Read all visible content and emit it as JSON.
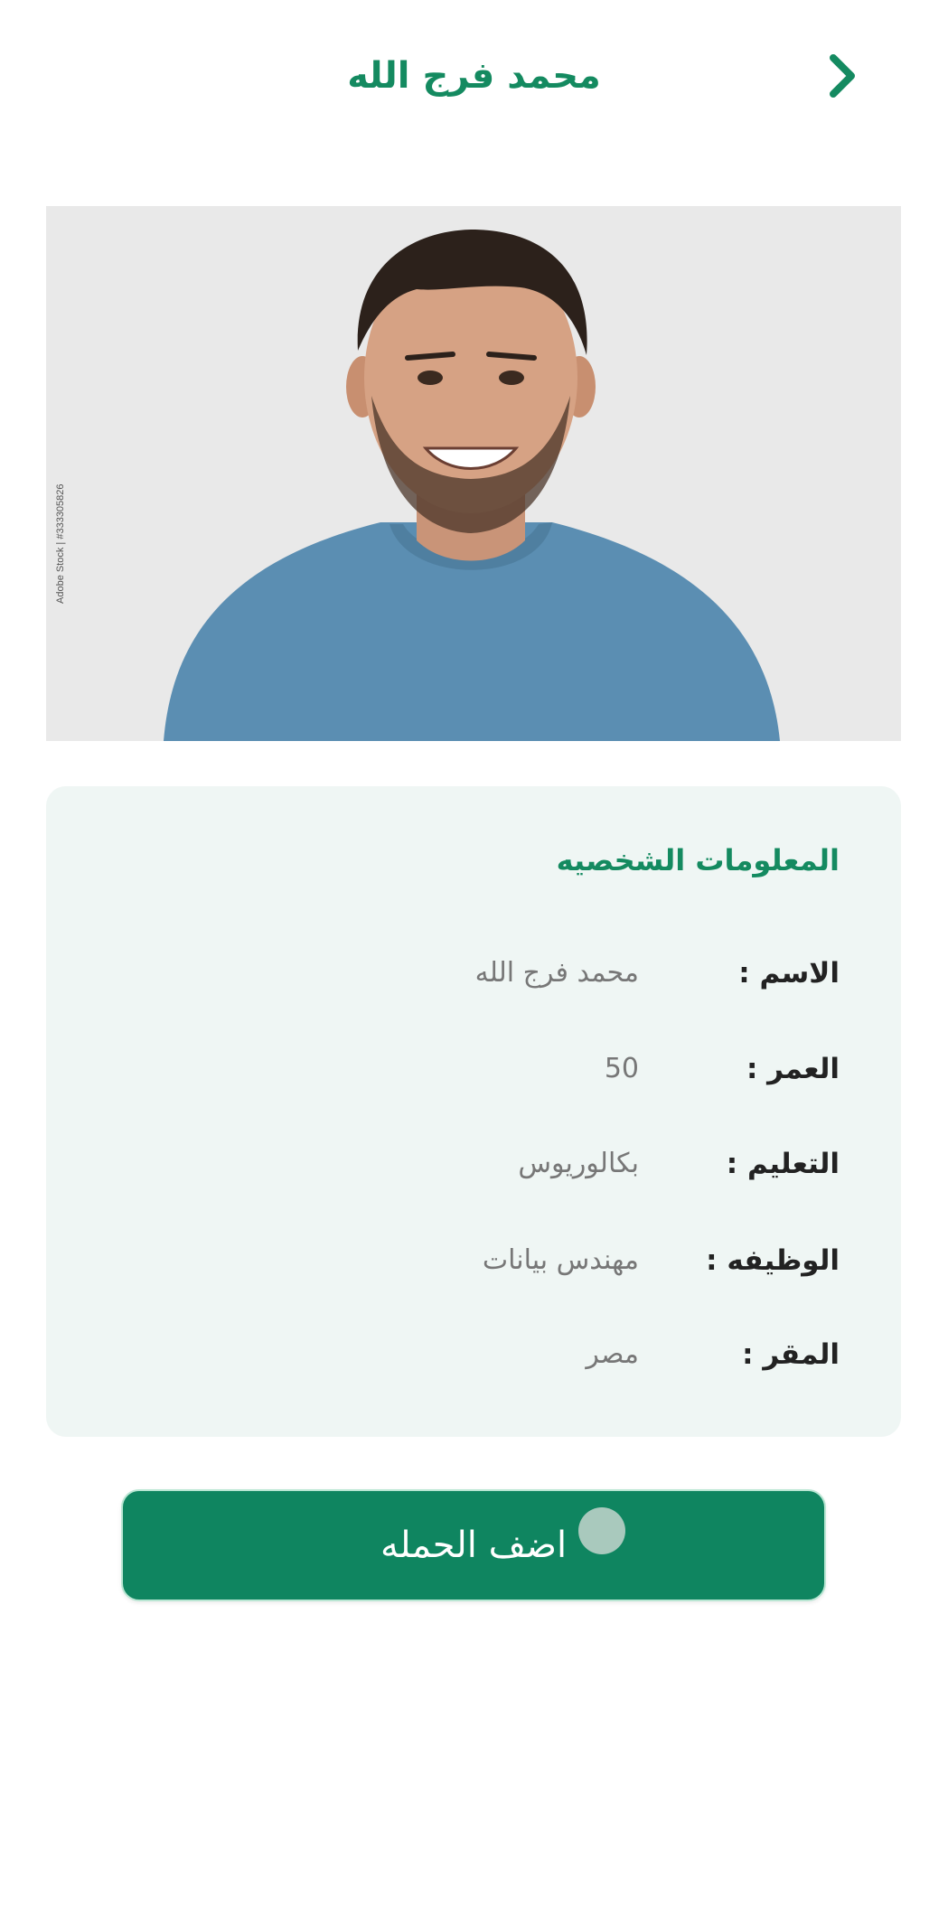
{
  "header": {
    "title": "محمد فرج الله",
    "back_icon": "chevron-right-icon"
  },
  "photo": {
    "credit": "Adobe Stock | #333305826"
  },
  "info": {
    "title": "المعلومات الشخصيه",
    "rows": [
      {
        "label": "الاسم :",
        "value": "محمد فرج الله"
      },
      {
        "label": "العمر :",
        "value": "50"
      },
      {
        "label": "التعليم :",
        "value": "بكالوريوس"
      },
      {
        "label": "الوظيفه :",
        "value": "مهندس بيانات"
      },
      {
        "label": "المقر :",
        "value": "مصر"
      }
    ]
  },
  "action": {
    "add_label": "اضف الحمله"
  },
  "colors": {
    "accent": "#148a60",
    "button": "#0f8560",
    "card_bg": "#eff6f4"
  }
}
